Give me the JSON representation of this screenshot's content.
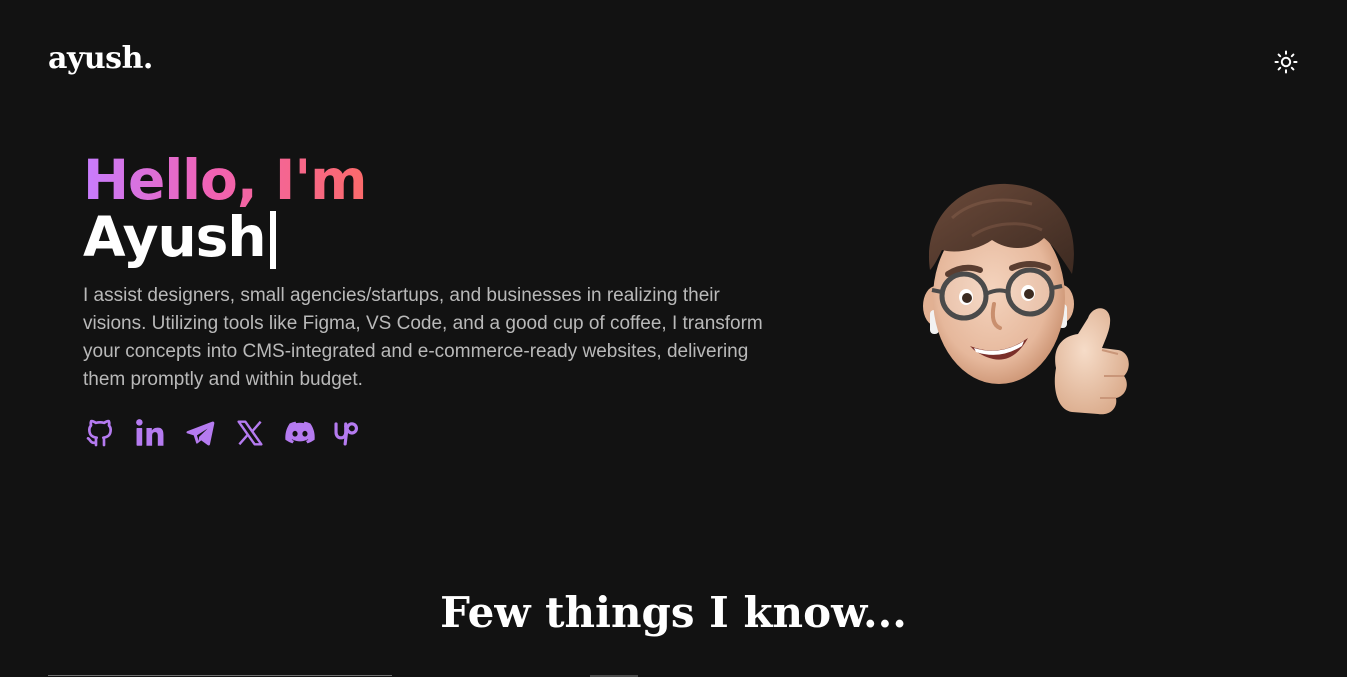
{
  "header": {
    "logo": "ayush.",
    "theme_toggle_icon": "sun-icon"
  },
  "hero": {
    "greeting": "Hello, I'm",
    "name": "Ayush",
    "intro": "I assist designers, small agencies/startups, and businesses in realizing their visions. Utilizing tools like Figma, VS Code, and a good cup of coffee, I transform your concepts into CMS-integrated and e-commerce-ready websites, delivering them promptly and within budget.",
    "gradient_colors": [
      "#c77dff",
      "#f062b4",
      "#fb6a6a"
    ],
    "socials": [
      {
        "icon": "github-icon"
      },
      {
        "icon": "linkedin-icon"
      },
      {
        "icon": "telegram-icon"
      },
      {
        "icon": "x-icon"
      },
      {
        "icon": "discord-icon"
      },
      {
        "icon": "upwork-icon"
      }
    ],
    "social_icon_color": "#b57bf0",
    "avatar": "memoji-avatar-thumbs-up"
  },
  "skills": {
    "title": "Few things I know..."
  },
  "colors": {
    "background": "#121212",
    "text": "#ffffff",
    "muted_text": "#b9b9b9"
  }
}
